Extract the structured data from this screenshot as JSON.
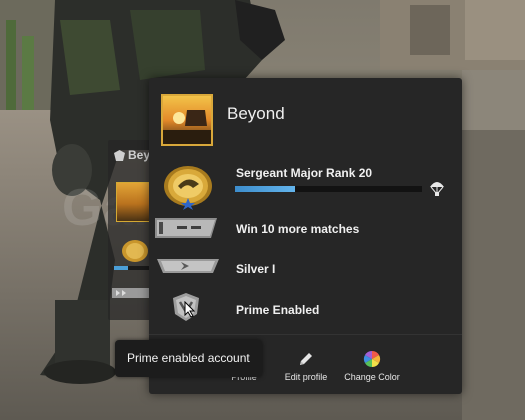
{
  "ghost_panel": {
    "username": "Beyond"
  },
  "profile": {
    "username": "Beyond",
    "rank": {
      "label": "Sergeant Major Rank 20",
      "progress": 0.32
    },
    "objective": {
      "label": "Win 10 more matches"
    },
    "competitive_rank": {
      "label": "Silver I"
    },
    "prime": {
      "label": "Prime Enabled"
    }
  },
  "actions": [
    {
      "label": "Profile",
      "icon": "profile-icon"
    },
    {
      "label": "Edit profile",
      "icon": "pencil-icon"
    },
    {
      "label": "Change Color",
      "icon": "color-wheel-icon"
    }
  ],
  "tooltip": {
    "text": "Prime enabled account"
  },
  "watermark": {
    "text": "Game Satis"
  },
  "colors": {
    "accent_blue": "#4b9fd8",
    "panel": "#262626",
    "avatar_border": "#d9a83a"
  }
}
